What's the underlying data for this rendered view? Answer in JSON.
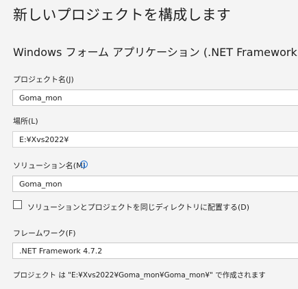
{
  "header": {
    "title": "新しいプロジェクトを構成します",
    "template_name": "Windows フォーム アプリケーション (.NET Framework)"
  },
  "form": {
    "project_name": {
      "label": "プロジェクト名(J)",
      "value": "Goma_mon"
    },
    "location": {
      "label": "場所(L)",
      "value": "E:¥Xvs2022¥"
    },
    "solution_name": {
      "label": "ソリューション名(M)",
      "value": "Goma_mon",
      "info_icon": "info-icon"
    },
    "same_directory": {
      "label": "ソリューションとプロジェクトを同じディレクトリに配置する(D)",
      "checked": false
    },
    "framework": {
      "label": "フレームワーク(F)",
      "value": ".NET Framework 4.7.2"
    }
  },
  "footer": {
    "note": "プロジェクト は \"E:¥Xvs2022¥Goma_mon¥Goma_mon¥\" で作成されます"
  },
  "colors": {
    "background": "#f4f4f4",
    "field_border": "#c8c8c8",
    "info_icon": "#1f6fd0"
  }
}
